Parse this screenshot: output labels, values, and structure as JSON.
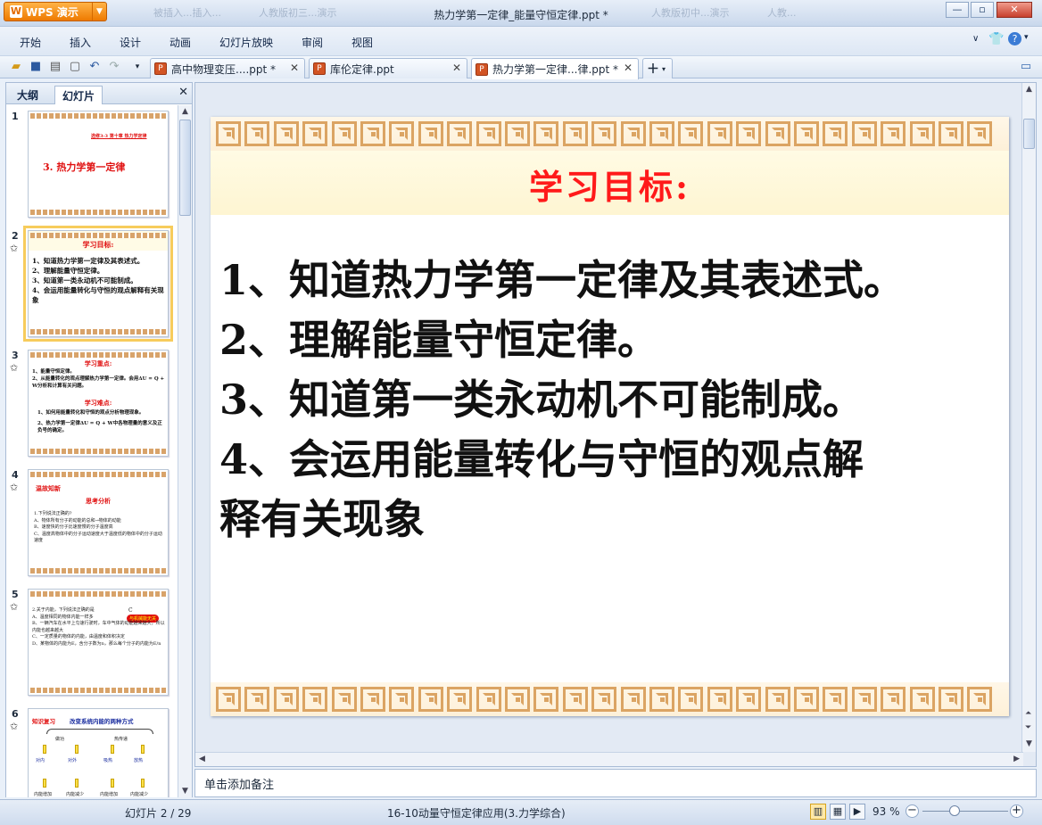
{
  "app": {
    "name": "WPS 演示",
    "window_title": "热力学第一定律_能量守恒定律.ppt *",
    "background_tabs": [
      "被插入...插入...",
      "人教版初三...演示",
      "人教版初中...演示",
      "人教..."
    ]
  },
  "menu": {
    "items": [
      "开始",
      "插入",
      "设计",
      "动画",
      "幻灯片放映",
      "审阅",
      "视图"
    ]
  },
  "quick_access": {
    "icons": [
      "open-folder-icon",
      "save-icon",
      "print-icon",
      "print-preview-icon",
      "undo-icon",
      "redo-icon",
      "customize-icon"
    ]
  },
  "doc_tabs": [
    {
      "label": "高中物理变压....ppt *",
      "active": false
    },
    {
      "label": "库伦定律.ppt",
      "active": false
    },
    {
      "label": "热力学第一定律...律.ppt *",
      "active": true
    }
  ],
  "left_pane": {
    "tabs": [
      "大纲",
      "幻灯片"
    ],
    "active_tab": "幻灯片",
    "slides": [
      {
        "num": "1",
        "title": "3. 热力学第一定律",
        "header": "选修3-3  第十章 热力学定律",
        "lines": []
      },
      {
        "num": "2",
        "title": "学习目标:",
        "lines": [
          "1、知道热力学第一定律及其表述式。",
          "2、理解能量守恒定律。",
          "3、知道第一类永动机不可能制成。",
          "4、会运用能量转化与守恒的观点解释有关现象"
        ]
      },
      {
        "num": "3",
        "title": "学习重点:",
        "lines": [
          "1、能量守恒定律。",
          "2、从能量转化的观点理解热力学第一定律。会用ΔU = Q + W分析和计算有关问题。"
        ],
        "title2": "学习难点:",
        "lines2": [
          "1、如何用能量转化和守恒的观点分析物理现象。",
          "2、热力学第一定律ΔU = Q + W中各物理量的意义及正负号的确定。"
        ]
      },
      {
        "num": "4",
        "title": "温故知新",
        "subtitle": "思考分析",
        "lines": [
          "1.下列说法正确的?",
          "A、物体所有分子的动能的总和→物体的动能",
          "B、速度快的分子比速度慢的分子温度高",
          "C、温度高物体中的分子运动速度大于温度低的物体中的分子运动速度"
        ]
      },
      {
        "num": "5",
        "title": "",
        "lines": [
          "2.关于内能，下列说法正确的是",
          "A、温度相同的物体内能一样多",
          "B、一辆汽车在水平上匀速行驶时，车中气体的动能越来越大，所以内能也越来越大",
          "C、一定质量的物体的内能，由温度和体积决定",
          "D、某物体的内能为E，含分子数为n，那么每个分子的内能为E/n"
        ],
        "badge": "与机械能无关",
        "answer": "C"
      },
      {
        "num": "6",
        "title": "知识复习",
        "subtitle": "改变系统内能的两种方式",
        "lines": [
          "做功",
          "热传递",
          "对内",
          "对外",
          "吸热",
          "放热",
          "内能增加",
          "内能减少",
          "内能增加",
          "内能减少"
        ]
      }
    ]
  },
  "slide": {
    "title": "学习目标:",
    "lines": [
      "1、知道热力学第一定律及其表述式。",
      "2、理解能量守恒定律。",
      "3、知道第一类永动机不可能制成。",
      "4、会运用能量转化与守恒的观点解",
      "释有关现象"
    ]
  },
  "notes": {
    "placeholder": "单击添加备注"
  },
  "status": {
    "slide_info": "幻灯片 2 / 29",
    "theme": "16-10动量守恒定律应用(3.力学综合)",
    "zoom": "93 %",
    "zoom_level": 0.38
  },
  "colors": {
    "accent": "#f7cc5c",
    "title_red": "#ff1a1a",
    "border_gold": "#dba463"
  }
}
